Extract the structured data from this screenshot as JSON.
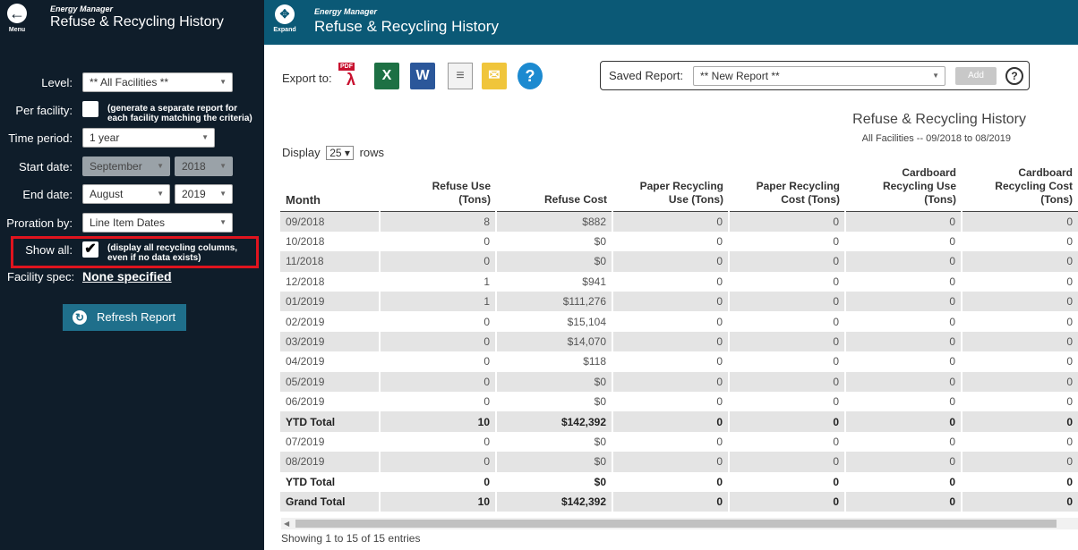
{
  "sidebar": {
    "menu_label": "Menu",
    "app_small": "Energy Manager",
    "app_title": "Refuse & Recycling History",
    "level": {
      "label": "Level:",
      "value": "** All Facilities **"
    },
    "per_facility": {
      "label": "Per facility:",
      "note": "(generate a separate report for each facility matching the criteria)"
    },
    "time_period": {
      "label": "Time period:",
      "value": "1 year"
    },
    "start_date": {
      "label": "Start date:",
      "month": "September",
      "year": "2018"
    },
    "end_date": {
      "label": "End date:",
      "month": "August",
      "year": "2019"
    },
    "proration": {
      "label": "Proration by:",
      "value": "Line Item Dates"
    },
    "show_all": {
      "label": "Show all:",
      "checked": true,
      "check_glyph": "✔",
      "note": "(display all recycling columns, even if no data exists)"
    },
    "facility_spec": {
      "label": "Facility spec:",
      "value": "None specified"
    },
    "refresh_label": "Refresh Report"
  },
  "topbar": {
    "expand_label": "Expand",
    "app_small": "Energy Manager",
    "title": "Refuse & Recycling History"
  },
  "toolbar": {
    "export_label": "Export to:",
    "pdf_text": "PDF",
    "icons": [
      "pdf-icon",
      "excel-icon",
      "word-icon",
      "text-icon",
      "email-icon",
      "help-icon"
    ],
    "saved_report_label": "Saved Report:",
    "saved_report_value": "** New Report **",
    "add_label": "Add",
    "help_glyph": "?"
  },
  "report": {
    "title": "Refuse & Recycling History",
    "subtitle": "All Facilities -- 09/2018 to 08/2019",
    "display_prefix": "Display",
    "display_value": "25 ▾",
    "display_suffix": "rows",
    "showing": "Showing 1 to 15 of 15 entries"
  },
  "table": {
    "headers": [
      [
        "Month"
      ],
      [
        "Refuse Use",
        "(Tons)"
      ],
      [
        "Refuse Cost"
      ],
      [
        "Paper Recycling",
        "Use (Tons)"
      ],
      [
        "Paper Recycling",
        "Cost (Tons)"
      ],
      [
        "Cardboard",
        "Recycling Use",
        "(Tons)"
      ],
      [
        "Cardboard",
        "Recycling Cost",
        "(Tons)"
      ]
    ],
    "rows": [
      {
        "cells": [
          "09/2018",
          "8",
          "$882",
          "0",
          "0",
          "0",
          "0"
        ],
        "total": false
      },
      {
        "cells": [
          "10/2018",
          "0",
          "$0",
          "0",
          "0",
          "0",
          "0"
        ],
        "total": false
      },
      {
        "cells": [
          "11/2018",
          "0",
          "$0",
          "0",
          "0",
          "0",
          "0"
        ],
        "total": false
      },
      {
        "cells": [
          "12/2018",
          "1",
          "$941",
          "0",
          "0",
          "0",
          "0"
        ],
        "total": false
      },
      {
        "cells": [
          "01/2019",
          "1",
          "$111,276",
          "0",
          "0",
          "0",
          "0"
        ],
        "total": false
      },
      {
        "cells": [
          "02/2019",
          "0",
          "$15,104",
          "0",
          "0",
          "0",
          "0"
        ],
        "total": false
      },
      {
        "cells": [
          "03/2019",
          "0",
          "$14,070",
          "0",
          "0",
          "0",
          "0"
        ],
        "total": false
      },
      {
        "cells": [
          "04/2019",
          "0",
          "$118",
          "0",
          "0",
          "0",
          "0"
        ],
        "total": false
      },
      {
        "cells": [
          "05/2019",
          "0",
          "$0",
          "0",
          "0",
          "0",
          "0"
        ],
        "total": false
      },
      {
        "cells": [
          "06/2019",
          "0",
          "$0",
          "0",
          "0",
          "0",
          "0"
        ],
        "total": false
      },
      {
        "cells": [
          "YTD Total",
          "10",
          "$142,392",
          "0",
          "0",
          "0",
          "0"
        ],
        "total": true
      },
      {
        "cells": [
          "07/2019",
          "0",
          "$0",
          "0",
          "0",
          "0",
          "0"
        ],
        "total": false
      },
      {
        "cells": [
          "08/2019",
          "0",
          "$0",
          "0",
          "0",
          "0",
          "0"
        ],
        "total": false
      },
      {
        "cells": [
          "YTD Total",
          "0",
          "$0",
          "0",
          "0",
          "0",
          "0"
        ],
        "total": true
      },
      {
        "cells": [
          "Grand Total",
          "10",
          "$142,392",
          "0",
          "0",
          "0",
          "0"
        ],
        "total": true
      }
    ]
  },
  "colors": {
    "sidebar_bg": "#0f1d2a",
    "topbar_bg": "#0b5976",
    "refresh_btn": "#1f6f8b",
    "highlight": "#e0141e"
  }
}
